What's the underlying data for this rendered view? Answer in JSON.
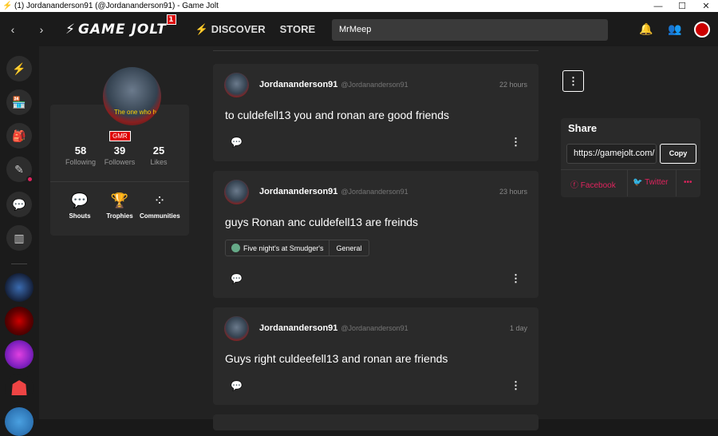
{
  "window": {
    "title": "(1) Jordananderson91 (@Jordananderson91) - Game Jolt",
    "minimize": "—",
    "maximize": "☐",
    "close": "✕"
  },
  "nav": {
    "back": "‹",
    "forward": "›",
    "logo_text": "GAME JOLT",
    "logo_badge": "1",
    "discover": "DISCOVER",
    "store": "STORE",
    "more": "⋮",
    "search_value": "MrMeep"
  },
  "profile": {
    "avatar_caption": "The one who hates tia sta",
    "tag": "GMR",
    "stats": [
      {
        "num": "58",
        "label": "Following"
      },
      {
        "num": "39",
        "label": "Followers"
      },
      {
        "num": "25",
        "label": "Likes"
      }
    ],
    "nav": [
      {
        "icon": "shouts-icon",
        "label": "Shouts"
      },
      {
        "icon": "trophy-icon",
        "label": "Trophies"
      },
      {
        "icon": "communities-icon",
        "label": "Communities"
      }
    ]
  },
  "posts": [
    {
      "name": "Jordananderson91",
      "user": "@Jordananderson91",
      "time": "22 hours",
      "body": "to culdefell13 you and ronan are good friends"
    },
    {
      "name": "Jordananderson91",
      "user": "@Jordananderson91",
      "time": "23 hours",
      "body": "guys Ronan anc culdefell13 are freinds",
      "game": "Five night's at Smudger's",
      "channel": "General"
    },
    {
      "name": "Jordananderson91",
      "user": "@Jordananderson91",
      "time": "1 day",
      "body": "Guys right culdeefell13 and ronan are friends"
    }
  ],
  "share": {
    "title": "Share",
    "url": "https://gamejolt.com/",
    "copy": "Copy",
    "facebook": "Facebook",
    "twitter": "Twitter",
    "more": "•••"
  },
  "colors": {
    "background": "#191919",
    "panel": "#2a2a2a",
    "accent": "#e0245e",
    "notification": "#dd0000"
  }
}
